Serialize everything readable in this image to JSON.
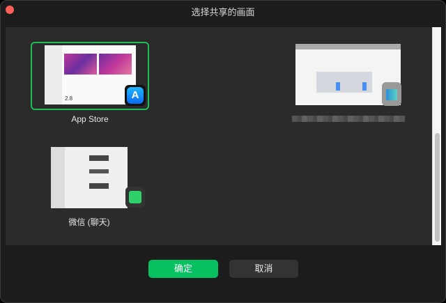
{
  "window": {
    "title": "选择共享的画面"
  },
  "sources": [
    {
      "label": "App Store",
      "selected": true,
      "icon": "app-store-icon"
    },
    {
      "label": "",
      "selected": false,
      "icon": "blurred-app-icon"
    },
    {
      "label": "微信 (聊天)",
      "selected": false,
      "icon": "wechat-icon"
    }
  ],
  "buttons": {
    "confirm": "确定",
    "cancel": "取消"
  },
  "colors": {
    "accent": "#07c160",
    "selection": "#1fbe5a"
  }
}
